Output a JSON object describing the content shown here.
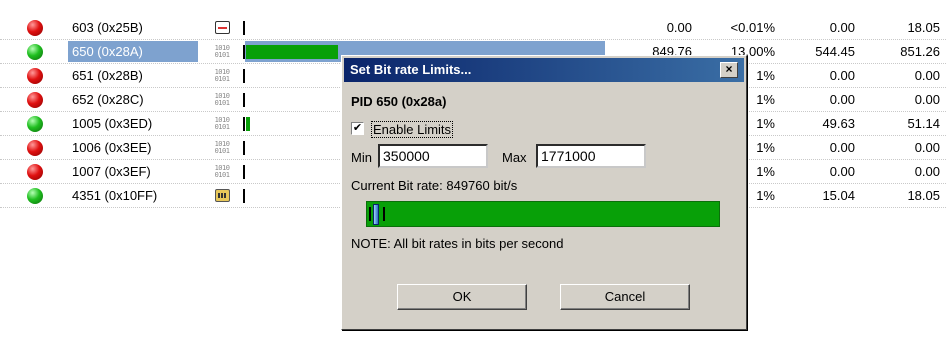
{
  "table": {
    "rows": [
      {
        "status": "red",
        "pid": "603 (0x25B)",
        "type_icon": "stop-box-icon",
        "c1": "0.00",
        "c2": "<0.01%",
        "c3": "0.00",
        "c4": "18.05",
        "bar": 0.0
      },
      {
        "status": "green",
        "pid": "650 (0x28A)",
        "type_icon": "binary-data-icon",
        "c1": "849.76",
        "c2": "13.00%",
        "c3": "544.45",
        "c4": "851.26",
        "bar": 1.0,
        "selected": true
      },
      {
        "status": "red",
        "pid": "651 (0x28B)",
        "type_icon": "binary-data-icon",
        "c1": "",
        "c2": "1%",
        "c3": "0.00",
        "c4": "0.00",
        "bar": 0.0
      },
      {
        "status": "red",
        "pid": "652 (0x28C)",
        "type_icon": "binary-data-icon",
        "c1": "",
        "c2": "1%",
        "c3": "0.00",
        "c4": "0.00",
        "bar": 0.0
      },
      {
        "status": "green",
        "pid": "1005 (0x3ED)",
        "type_icon": "binary-data-icon",
        "c1": "",
        "c2": "1%",
        "c3": "49.63",
        "c4": "51.14",
        "bar": 0.04
      },
      {
        "status": "red",
        "pid": "1006 (0x3EE)",
        "type_icon": "binary-data-icon",
        "c1": "",
        "c2": "1%",
        "c3": "0.00",
        "c4": "0.00",
        "bar": 0.0
      },
      {
        "status": "red",
        "pid": "1007 (0x3EF)",
        "type_icon": "binary-data-icon",
        "c1": "",
        "c2": "1%",
        "c3": "0.00",
        "c4": "0.00",
        "bar": 0.0
      },
      {
        "status": "green",
        "pid": "4351 (0x10FF)",
        "type_icon": "keyboard-icon",
        "c1": "",
        "c2": "1%",
        "c3": "15.04",
        "c4": "18.05",
        "bar": 0.0
      }
    ]
  },
  "dialog": {
    "title": "Set Bit rate Limits...",
    "close_label": "×",
    "pid_title": "PID 650 (0x28a)",
    "enable_limits_label": "Enable Limits",
    "enable_limits_checked": "✔",
    "min_label": "Min",
    "min_value": "350000",
    "max_label": "Max",
    "max_value": "1771000",
    "current_bitrate": "Current Bit rate: 849760 bit/s",
    "note": "NOTE: All bit rates in bits per second",
    "ok_label": "OK",
    "cancel_label": "Cancel"
  },
  "colors": {
    "selection": "#7ea2cf",
    "bar_green": "#08a008",
    "titlebar_start": "#0a246a",
    "titlebar_end": "#3a6ea5",
    "dialog_face": "#d4d0c8"
  }
}
